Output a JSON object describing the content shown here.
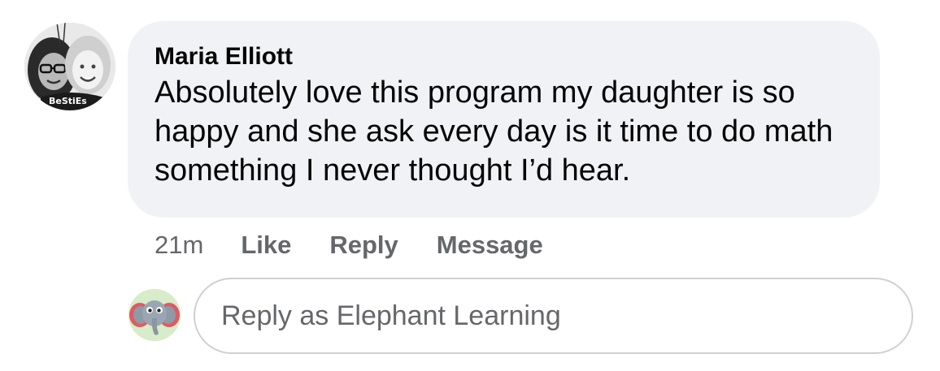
{
  "comment": {
    "author": "Maria Elliott",
    "text": "Absolutely love this program my daughter is so happy and she ask every day is it time to do math something I never thought I’d hear.",
    "avatar_caption": "BeStiEs",
    "timestamp": "21m",
    "actions": {
      "like": "Like",
      "reply": "Reply",
      "message": "Message"
    }
  },
  "reply_box": {
    "placeholder": "Reply as Elephant Learning",
    "value": ""
  },
  "colors": {
    "bubble_background": "#f0f2f5",
    "secondary_text": "#65676b",
    "primary_text": "#050505",
    "input_border": "#ced0d4"
  },
  "icons": {
    "commenter_avatar": "profile-photo-avatar",
    "reply_avatar": "elephant-avatar"
  }
}
